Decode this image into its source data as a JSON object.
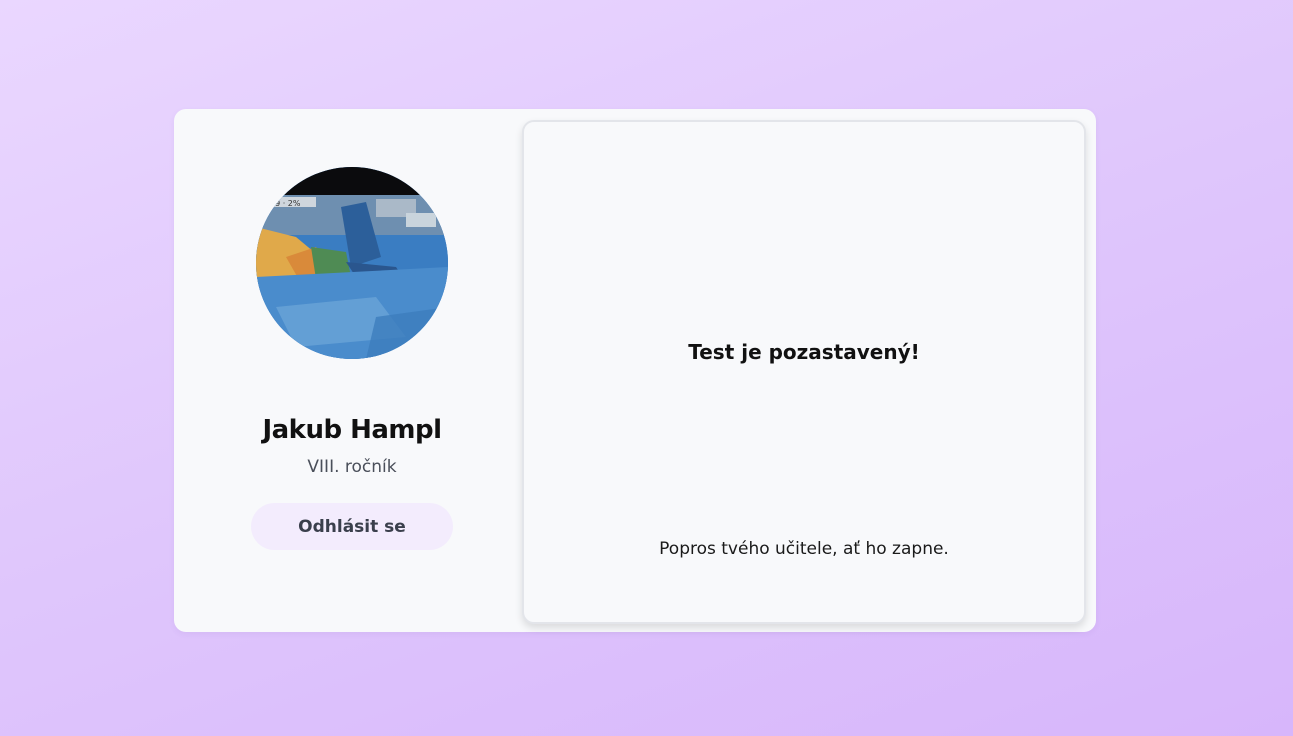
{
  "profile": {
    "name": "Jakub Hampl",
    "grade": "VIII. ročník",
    "logout_label": "Odhlásit se",
    "avatar_overlay_text": "49 · 2%"
  },
  "panel": {
    "title": "Test je pozastavený!",
    "message": "Popros tvého učitele, ať ho zapne."
  },
  "colors": {
    "background_start": "#ead7ff",
    "background_end": "#d7b6fb",
    "card": "#f8f9fb",
    "button_bg": "#f3ecfd",
    "button_text": "#3a3f4c"
  }
}
